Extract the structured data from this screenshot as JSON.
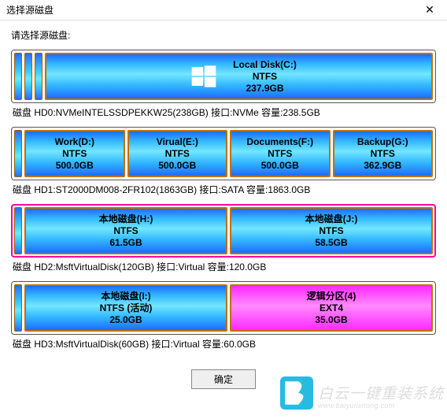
{
  "window": {
    "title": "选择源磁盘",
    "close_glyph": "✕"
  },
  "prompt": "请选择源磁盘:",
  "disks": [
    {
      "partitions": [
        {
          "name": "Local Disk(C:)",
          "fs": "NTFS",
          "size": "237.9GB",
          "hasWinIcon": true
        }
      ],
      "info": "磁盘 HD0:NVMeINTELSSDPEKKW25(238GB)  接口:NVMe  容量:238.5GB",
      "leading_slots": 3
    },
    {
      "partitions": [
        {
          "name": "Work(D:)",
          "fs": "NTFS",
          "size": "500.0GB"
        },
        {
          "name": "Virual(E:)",
          "fs": "NTFS",
          "size": "500.0GB"
        },
        {
          "name": "Documents(F:)",
          "fs": "NTFS",
          "size": "500.0GB"
        },
        {
          "name": "Backup(G:)",
          "fs": "NTFS",
          "size": "362.9GB"
        }
      ],
      "info": "磁盘 HD1:ST2000DM008-2FR102(1863GB)  接口:SATA  容量:1863.0GB",
      "leading_slots": 1
    },
    {
      "selected": true,
      "partitions": [
        {
          "name": "本地磁盘(H:)",
          "fs": "NTFS",
          "size": "61.5GB"
        },
        {
          "name": "本地磁盘(J:)",
          "fs": "NTFS",
          "size": "58.5GB"
        }
      ],
      "info": "磁盘 HD2:MsftVirtualDisk(120GB)  接口:Virtual  容量:120.0GB",
      "leading_slots": 1
    },
    {
      "partitions": [
        {
          "name": "本地磁盘(I:)",
          "fs": "NTFS (活动)",
          "size": "25.0GB"
        },
        {
          "name": "逻辑分区(4)",
          "fs": "EXT4",
          "size": "35.0GB",
          "magenta": true
        }
      ],
      "info": "磁盘 HD3:MsftVirtualDisk(60GB)  接口:Virtual  容量:60.0GB",
      "leading_slots": 1
    }
  ],
  "footer": {
    "ok": "确定"
  },
  "brand": {
    "text": "白云一键重装系统",
    "url": "www.baiyunxitong.com"
  }
}
